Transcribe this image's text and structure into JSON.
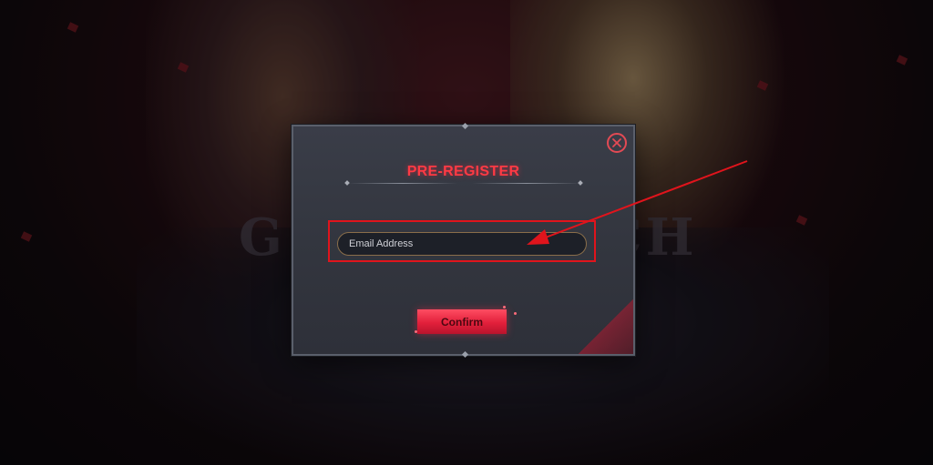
{
  "modal": {
    "title": "PRE-REGISTER",
    "email_placeholder": "Email Address",
    "email_value": "",
    "confirm_label": "Confirm",
    "close_icon": "close-circle-icon"
  },
  "background": {
    "title_left": "G",
    "title_right": "CH"
  },
  "colors": {
    "accent": "#ff3a44",
    "annotation": "#e0141c",
    "modal_bg": "#363942",
    "button": "#e2203b"
  }
}
